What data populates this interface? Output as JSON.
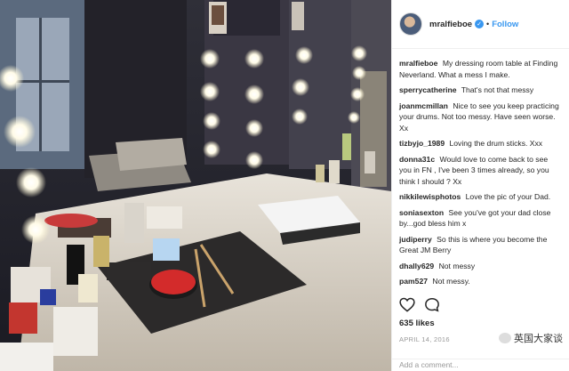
{
  "post": {
    "username": "mralfieboe",
    "follow_label": "Follow",
    "caption_user": "mralfieboe",
    "caption_text": "My dressing room table at Finding Neverland. What a mess I make.",
    "comments": [
      {
        "user": "sperrycatherine",
        "text": "That's not that messy"
      },
      {
        "user": "joanmcmillan",
        "text": "Nice to see you keep practicing your drums. Not too messy. Have seen worse. Xx"
      },
      {
        "user": "tizbyjo_1989",
        "text": "Loving the drum sticks. Xxx"
      },
      {
        "user": "donna31c",
        "text": "Would love to come back to see you in FN , I've been 3 times already, so you think I should ? Xx"
      },
      {
        "user": "nikkilewisphotos",
        "text": "Love the pic of your Dad."
      },
      {
        "user": "soniasexton",
        "text": "See you've got your dad close by...god bless him x"
      },
      {
        "user": "judiperry",
        "text": "So this is where you become the Great JM Berry"
      },
      {
        "user": "dhally629",
        "text": "Not messy"
      },
      {
        "user": "pam527",
        "text": "Not messy."
      }
    ],
    "likes": "635 likes",
    "date": "APRIL 14, 2016",
    "add_comment_placeholder": "Add a comment..."
  },
  "watermark": "英国大家谈",
  "icons": {
    "like": "heart-icon",
    "comment": "comment-bubble-icon",
    "verified": "verified-badge-icon"
  },
  "colors": {
    "accent": "#3897f0",
    "text": "#262626",
    "muted": "#999999"
  }
}
